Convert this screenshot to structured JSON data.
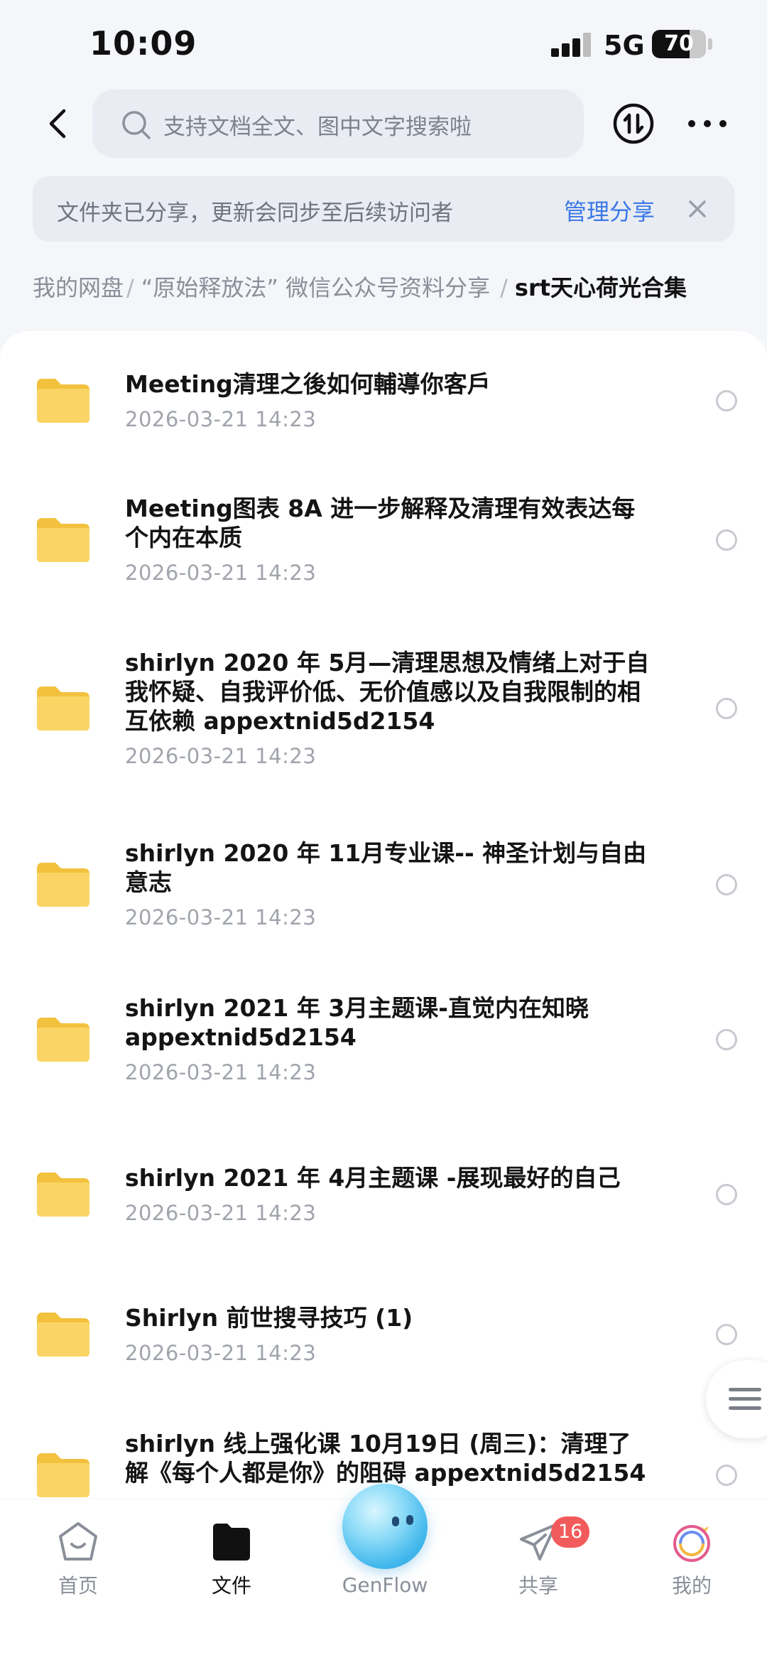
{
  "status_bar": {
    "time": "10:09",
    "network": "5G",
    "battery": "70",
    "battery_level": 0.7
  },
  "header": {
    "search_placeholder": "支持文档全文、图中文字搜索啦"
  },
  "share_banner": {
    "text": "文件夹已分享，更新会同步至后续访问者",
    "manage_label": "管理分享"
  },
  "breadcrumb": {
    "items": [
      "我的网盘",
      "“原始释放法” 微信公众号资料分享"
    ],
    "separator": "/",
    "current": "srt天心荷光合集"
  },
  "files": [
    {
      "name": "Meeting清理之後如何輔導你客戶",
      "date": "2026-03-21 14:23"
    },
    {
      "name": "Meeting图表 8A 进一步解释及清理有效表达每个内在本质",
      "date": "2026-03-21 14:23"
    },
    {
      "name": "shirlyn 2020 年 5月—清理思想及情绪上对于自我怀疑、自我评价低、无价值感以及自我限制的相互依赖 appextnid5d2154",
      "date": "2026-03-21 14:23"
    },
    {
      "name": "shirlyn 2020 年 11月专业课-- 神圣计划与自由意志",
      "date": "2026-03-21 14:23"
    },
    {
      "name": "shirlyn 2021 年 3月主题课-直觉内在知晓 appextnid5d2154",
      "date": "2026-03-21 14:23"
    },
    {
      "name": "shirlyn 2021 年 4月主题课 -展现最好的自己",
      "date": "2026-03-21 14:23"
    },
    {
      "name": "Shirlyn 前世搜寻技巧 (1)",
      "date": "2026-03-21 14:23"
    },
    {
      "name": "shirlyn 线上强化课 10月19日 (周三)：清理了解《每个人都是你》的阻碍 appextnid5d2154",
      "date": ""
    }
  ],
  "tabbar": {
    "home": "首页",
    "files": "文件",
    "genflow": "GenFlow",
    "share": "共享",
    "share_badge": "16",
    "mine": "我的"
  },
  "colors": {
    "accent": "#3b78e8",
    "folder": "#f8cf4e",
    "badge": "#f25b5b"
  },
  "icons": [
    "back-arrow-icon",
    "search-icon",
    "sort-icon",
    "more-icon",
    "close-icon",
    "folder-icon",
    "menu-lines-icon",
    "home-icon",
    "files-icon",
    "genflow-mascot-icon",
    "share-plane-icon",
    "avatar-icon"
  ]
}
